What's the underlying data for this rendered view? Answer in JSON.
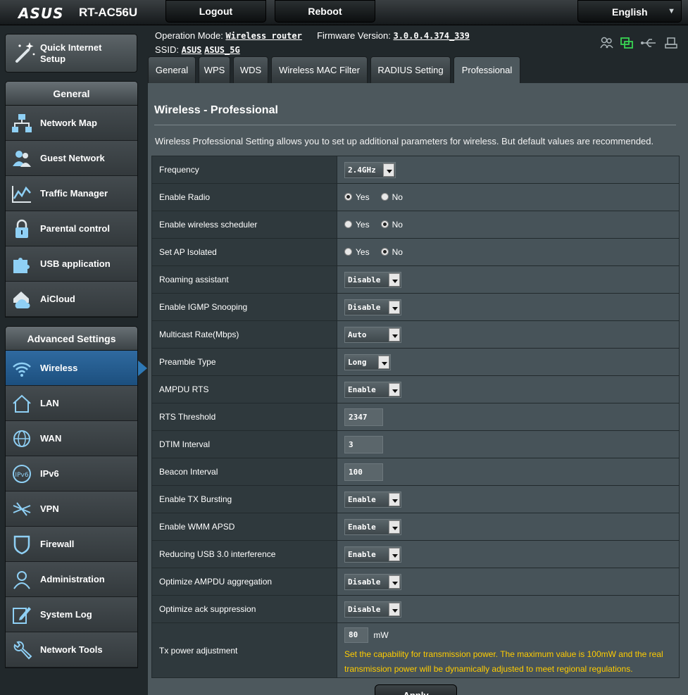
{
  "header": {
    "brand": "ASUS",
    "model": "RT-AC56U",
    "logout_label": "Logout",
    "reboot_label": "Reboot",
    "language": "English"
  },
  "info": {
    "operation_mode_label": "Operation Mode:",
    "operation_mode_value": "Wireless router",
    "firmware_label": "Firmware Version:",
    "firmware_value": "3.0.0.4.374_339",
    "ssid_label": "SSID:",
    "ssid_values": [
      "ASUS",
      "ASUS_5G"
    ]
  },
  "sidebar": {
    "quick_setup_label": "Quick Internet Setup",
    "general_title": "General",
    "general_items": [
      {
        "label": "Network Map",
        "icon": "network-map-icon"
      },
      {
        "label": "Guest Network",
        "icon": "guest-network-icon"
      },
      {
        "label": "Traffic Manager",
        "icon": "traffic-manager-icon"
      },
      {
        "label": "Parental control",
        "icon": "parental-control-icon"
      },
      {
        "label": "USB application",
        "icon": "usb-application-icon"
      },
      {
        "label": "AiCloud",
        "icon": "aicloud-icon"
      }
    ],
    "advanced_title": "Advanced Settings",
    "advanced_items": [
      {
        "label": "Wireless",
        "icon": "wireless-icon",
        "active": true
      },
      {
        "label": "LAN",
        "icon": "lan-icon"
      },
      {
        "label": "WAN",
        "icon": "wan-icon"
      },
      {
        "label": "IPv6",
        "icon": "ipv6-icon"
      },
      {
        "label": "VPN",
        "icon": "vpn-icon"
      },
      {
        "label": "Firewall",
        "icon": "firewall-icon"
      },
      {
        "label": "Administration",
        "icon": "administration-icon"
      },
      {
        "label": "System Log",
        "icon": "system-log-icon"
      },
      {
        "label": "Network Tools",
        "icon": "network-tools-icon"
      }
    ]
  },
  "tabs": [
    {
      "label": "General"
    },
    {
      "label": "WPS"
    },
    {
      "label": "WDS"
    },
    {
      "label": "Wireless MAC Filter"
    },
    {
      "label": "RADIUS Setting"
    },
    {
      "label": "Professional",
      "active": true
    }
  ],
  "page": {
    "title": "Wireless - Professional",
    "description": "Wireless Professional Setting allows you to set up additional parameters for wireless. But default values are recommended.",
    "settings": [
      {
        "label": "Frequency",
        "type": "select",
        "value": "2.4GHz"
      },
      {
        "label": "Enable Radio",
        "type": "radio",
        "value": "Yes"
      },
      {
        "label": "Enable wireless scheduler",
        "type": "radio",
        "value": "No"
      },
      {
        "label": "Set AP Isolated",
        "type": "radio",
        "value": "No"
      },
      {
        "label": "Roaming assistant",
        "type": "select",
        "value": "Disable"
      },
      {
        "label": "Enable IGMP Snooping",
        "type": "select",
        "value": "Disable"
      },
      {
        "label": "Multicast Rate(Mbps)",
        "type": "select",
        "value": "Auto"
      },
      {
        "label": "Preamble Type",
        "type": "select",
        "value": "Long"
      },
      {
        "label": "AMPDU RTS",
        "type": "select",
        "value": "Enable"
      },
      {
        "label": "RTS Threshold",
        "type": "text",
        "value": "2347"
      },
      {
        "label": "DTIM Interval",
        "type": "text",
        "value": "3"
      },
      {
        "label": "Beacon Interval",
        "type": "text",
        "value": "100"
      },
      {
        "label": "Enable TX Bursting",
        "type": "select",
        "value": "Enable"
      },
      {
        "label": "Enable WMM APSD",
        "type": "select",
        "value": "Enable"
      },
      {
        "label": "Reducing USB 3.0 interference",
        "type": "select",
        "value": "Enable"
      },
      {
        "label": "Optimize AMPDU aggregation",
        "type": "select",
        "value": "Disable"
      },
      {
        "label": "Optimize ack suppression",
        "type": "select",
        "value": "Disable"
      }
    ],
    "radio_options": [
      "Yes",
      "No"
    ],
    "tx_power": {
      "label": "Tx power adjustment",
      "value": "80",
      "unit": "mW",
      "note": "Set the capability for transmission power. The maximum value is 100mW and the real transmission power will be dynamically adjusted to meet regional regulations."
    },
    "apply_label": "Apply"
  },
  "colors": {
    "accent": "#2e78b5",
    "note": "#ffcc00",
    "panel": "#4d585d",
    "status_green": "#39d353"
  }
}
